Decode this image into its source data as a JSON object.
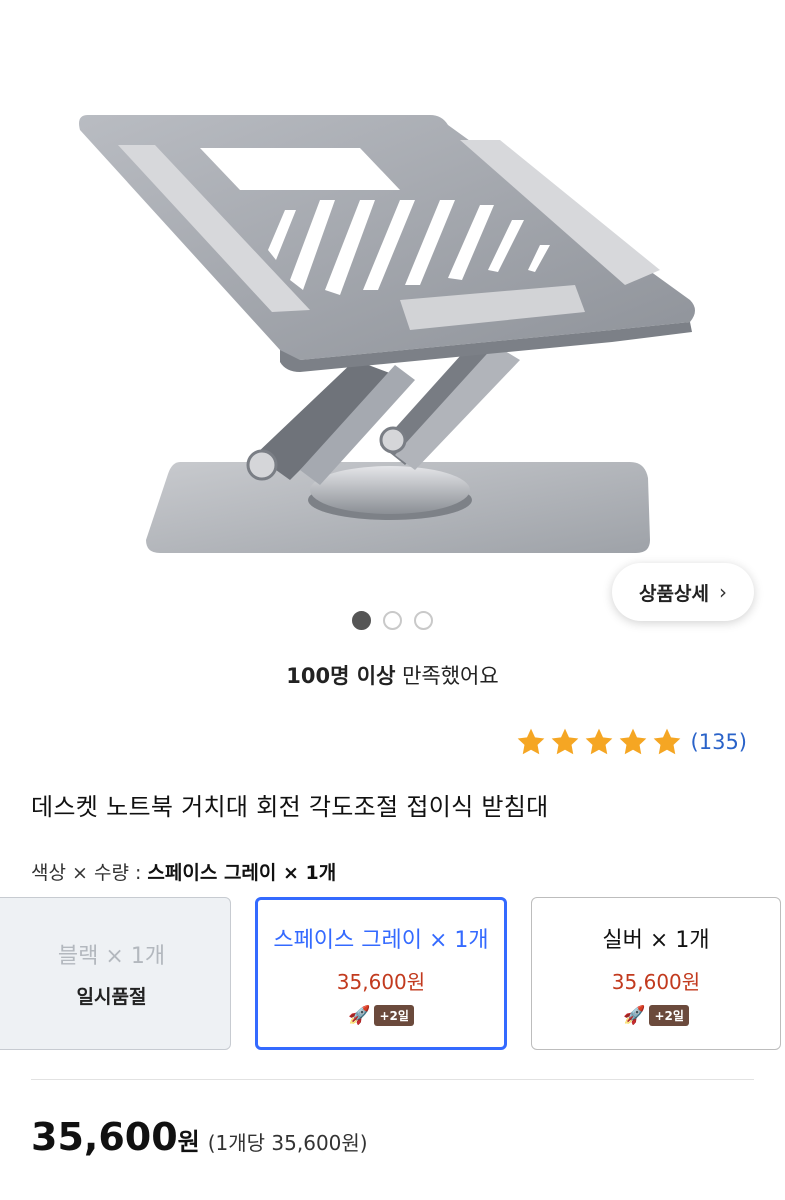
{
  "product_image": {
    "alt": "laptop-stand-product-image"
  },
  "detail_button": {
    "label": "상품상세",
    "chevron": "›"
  },
  "carousel": {
    "count": 3,
    "active": 0
  },
  "satisfaction": {
    "highlight": "100명 이상",
    "rest": " 만족했어요"
  },
  "rating": {
    "stars": 5,
    "count": "(135)",
    "star_color": "#f5a623"
  },
  "product": {
    "title": "데스켓 노트북 거치대 회전 각도조절 접이식 받침대"
  },
  "option_summary": {
    "label": "색상 × 수량 : ",
    "value": "스페이스 그레이 × 1개"
  },
  "options": [
    {
      "name": "블랙 × 1개",
      "status": "일시품절"
    },
    {
      "name": "스페이스 그레이 × 1개",
      "price": "35,600원",
      "badge": "+2일",
      "rocket": "🚀"
    },
    {
      "name": "실버 × 1개",
      "price": "35,600원",
      "badge": "+2일",
      "rocket": "🚀"
    }
  ],
  "price": {
    "amount": "35,600",
    "unit": "원",
    "per_unit": "(1개당 35,600원)"
  },
  "colors": {
    "accent": "#346aff",
    "price_red": "#c23a1e",
    "rating_blue": "#2a63c9",
    "badge_brown": "#6b4a3c"
  }
}
